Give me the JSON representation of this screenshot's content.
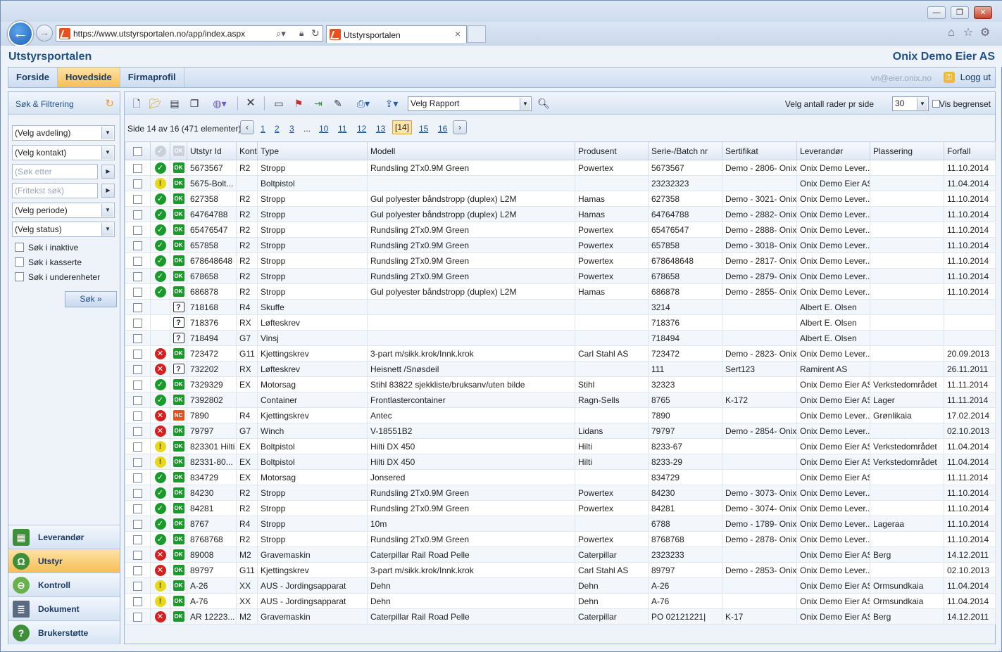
{
  "browser": {
    "url": "https://www.utstyrsportalen.no/app/index.aspx",
    "tab_title": "Utstyrsportalen"
  },
  "header": {
    "app_title": "Utstyrsportalen",
    "company": "Onix Demo Eier AS"
  },
  "menu": {
    "items": [
      {
        "label": "Forside"
      },
      {
        "label": "Hovedside"
      },
      {
        "label": "Firmaprofil"
      }
    ],
    "active": "Hovedside",
    "user_email": "vn@eier.onix.no",
    "logout": "Logg ut"
  },
  "sidebar": {
    "filter_title": "Søk & Filtrering",
    "selects": {
      "department": "(Velg avdeling)",
      "contact": "(Velg kontakt)",
      "period": "(Velg periode)",
      "status": "(Velg status)"
    },
    "inputs": {
      "supplier_placeholder": "(Søk etter leverandør)",
      "freetext_placeholder": "(Fritekst søk)"
    },
    "checkboxes": {
      "inactive": "Søk i inaktive",
      "discarded": "Søk i kasserte",
      "subunits": "Søk i underenheter"
    },
    "search_button": "Søk »",
    "nav": [
      {
        "label": "Leverandør"
      },
      {
        "label": "Utstyr"
      },
      {
        "label": "Kontroll"
      },
      {
        "label": "Dokument"
      },
      {
        "label": "Brukerstøtte"
      }
    ],
    "nav_active": "Utstyr"
  },
  "toolbar": {
    "report_select": "Velg Rapport",
    "rows_label": "Velg antall rader pr side",
    "rows_value": "30",
    "limited_label": "Vis begrenset"
  },
  "pager": {
    "text": "Side 14 av 16 (471 elementer)",
    "pages": [
      "1",
      "2",
      "3",
      "...",
      "10",
      "11",
      "12",
      "13",
      "[14]",
      "15",
      "16"
    ],
    "current": "[14]"
  },
  "grid": {
    "columns": [
      "Utstyr Id",
      "Kontr",
      "Type",
      "Modell",
      "Produsent",
      "Serie-/Batch nr",
      "Sertifikat",
      "Leverandør",
      "Plassering",
      "Forfall"
    ],
    "rows": [
      {
        "status": "ok",
        "cert": "ok",
        "id": "5673567",
        "kontr": "R2",
        "type": "Stropp",
        "modell": "Rundsling 2Tx0.9M Green",
        "produsent": "Powertex",
        "serie": "5673567",
        "sertifikat": "Demo - 2806- Onix",
        "leverandor": "Onix Demo Lever...",
        "plassering": "",
        "forfall": "11.10.2014"
      },
      {
        "status": "warn",
        "cert": "ok",
        "id": "5675-Bolt...",
        "kontr": "",
        "type": "Boltpistol",
        "modell": "",
        "produsent": "",
        "serie": "23232323",
        "sertifikat": "",
        "leverandor": "Onix Demo Eier AS",
        "plassering": "",
        "forfall": "11.04.2014"
      },
      {
        "status": "ok",
        "cert": "ok",
        "id": "627358",
        "kontr": "R2",
        "type": "Stropp",
        "modell": "Gul polyester båndstropp (duplex) L2M",
        "produsent": "Hamas",
        "serie": "627358",
        "sertifikat": "Demo - 3021- Onix",
        "leverandor": "Onix Demo Lever...",
        "plassering": "",
        "forfall": "11.10.2014"
      },
      {
        "status": "ok",
        "cert": "ok",
        "id": "64764788",
        "kontr": "R2",
        "type": "Stropp",
        "modell": "Gul polyester båndstropp (duplex) L2M",
        "produsent": "Hamas",
        "serie": "64764788",
        "sertifikat": "Demo - 2882- Onix",
        "leverandor": "Onix Demo Lever...",
        "plassering": "",
        "forfall": "11.10.2014"
      },
      {
        "status": "ok",
        "cert": "ok",
        "id": "65476547",
        "kontr": "R2",
        "type": "Stropp",
        "modell": "Rundsling 2Tx0.9M Green",
        "produsent": "Powertex",
        "serie": "65476547",
        "sertifikat": "Demo - 2888- Onix",
        "leverandor": "Onix Demo Lever...",
        "plassering": "",
        "forfall": "11.10.2014"
      },
      {
        "status": "ok",
        "cert": "ok",
        "id": "657858",
        "kontr": "R2",
        "type": "Stropp",
        "modell": "Rundsling 2Tx0.9M Green",
        "produsent": "Powertex",
        "serie": "657858",
        "sertifikat": "Demo - 3018- Onix",
        "leverandor": "Onix Demo Lever...",
        "plassering": "",
        "forfall": "11.10.2014"
      },
      {
        "status": "ok",
        "cert": "ok",
        "id": "678648648",
        "kontr": "R2",
        "type": "Stropp",
        "modell": "Rundsling 2Tx0.9M Green",
        "produsent": "Powertex",
        "serie": "678648648",
        "sertifikat": "Demo - 2817- Onix",
        "leverandor": "Onix Demo Lever...",
        "plassering": "",
        "forfall": "11.10.2014"
      },
      {
        "status": "ok",
        "cert": "ok",
        "id": "678658",
        "kontr": "R2",
        "type": "Stropp",
        "modell": "Rundsling 2Tx0.9M Green",
        "produsent": "Powertex",
        "serie": "678658",
        "sertifikat": "Demo - 2879- Onix",
        "leverandor": "Onix Demo Lever...",
        "plassering": "",
        "forfall": "11.10.2014"
      },
      {
        "status": "ok",
        "cert": "ok",
        "id": "686878",
        "kontr": "R2",
        "type": "Stropp",
        "modell": "Gul polyester båndstropp (duplex) L2M",
        "produsent": "Hamas",
        "serie": "686878",
        "sertifikat": "Demo - 2855- Onix",
        "leverandor": "Onix Demo Lever...",
        "plassering": "",
        "forfall": "11.10.2014"
      },
      {
        "status": "",
        "cert": "q",
        "id": "718168",
        "kontr": "R4",
        "type": "Skuffe",
        "modell": "",
        "produsent": "",
        "serie": "3214",
        "sertifikat": "",
        "leverandor": "Albert E. Olsen",
        "plassering": "",
        "forfall": ""
      },
      {
        "status": "",
        "cert": "q",
        "id": "718376",
        "kontr": "RX",
        "type": "Løfteskrev",
        "modell": "",
        "produsent": "",
        "serie": "718376",
        "sertifikat": "",
        "leverandor": "Albert E. Olsen",
        "plassering": "",
        "forfall": ""
      },
      {
        "status": "",
        "cert": "q",
        "id": "718494",
        "kontr": "G7",
        "type": "Vinsj",
        "modell": "",
        "produsent": "",
        "serie": "718494",
        "sertifikat": "",
        "leverandor": "Albert E. Olsen",
        "plassering": "",
        "forfall": ""
      },
      {
        "status": "err",
        "cert": "ok",
        "id": "723472",
        "kontr": "G11",
        "type": "Kjettingskrev",
        "modell": "3-part m/sikk.krok/Innk.krok",
        "produsent": "Carl Stahl AS",
        "serie": "723472",
        "sertifikat": "Demo - 2823- Onix",
        "leverandor": "Onix Demo Lever...",
        "plassering": "",
        "forfall": "20.09.2013"
      },
      {
        "status": "err",
        "cert": "q",
        "id": "732202",
        "kontr": "RX",
        "type": "Løfteskrev",
        "modell": "Heisnett /Snøsdeil",
        "produsent": "",
        "serie": "111",
        "sertifikat": "Sert123",
        "leverandor": "Ramirent AS",
        "plassering": "",
        "forfall": "26.11.2011"
      },
      {
        "status": "ok",
        "cert": "ok",
        "id": "7329329",
        "kontr": "EX",
        "type": "Motorsag",
        "modell": "Stihl 83822 sjekkliste/bruksanv/uten bilde",
        "produsent": "Stihl",
        "serie": "32323",
        "sertifikat": "",
        "leverandor": "Onix Demo Eier AS",
        "plassering": "Verkstedområdet",
        "forfall": "11.11.2014"
      },
      {
        "status": "ok",
        "cert": "ok",
        "id": "7392802",
        "kontr": "",
        "type": "Container",
        "modell": "Frontlastercontainer",
        "produsent": "Ragn-Sells",
        "serie": "8765",
        "sertifikat": "K-172",
        "leverandor": "Onix Demo Eier AS",
        "plassering": "Lager",
        "forfall": "11.11.2014"
      },
      {
        "status": "err",
        "cert": "nc",
        "id": "7890",
        "kontr": "R4",
        "type": "Kjettingskrev",
        "modell": "Antec",
        "produsent": "",
        "serie": "7890",
        "sertifikat": "",
        "leverandor": "Onix Demo Lever...",
        "plassering": "Grønlikaia",
        "forfall": "17.02.2014"
      },
      {
        "status": "err",
        "cert": "ok",
        "id": "79797",
        "kontr": "G7",
        "type": "Winch",
        "modell": "V-18551B2",
        "produsent": "Lidans",
        "serie": "79797",
        "sertifikat": "Demo - 2854- Onix",
        "leverandor": "Onix Demo Lever...",
        "plassering": "",
        "forfall": "02.10.2013"
      },
      {
        "status": "warn",
        "cert": "ok",
        "id": "823301 Hilti",
        "kontr": "EX",
        "type": "Boltpistol",
        "modell": "Hilti DX 450",
        "produsent": "Hilti",
        "serie": "8233-67",
        "sertifikat": "",
        "leverandor": "Onix Demo Eier AS",
        "plassering": "Verkstedområdet",
        "forfall": "11.04.2014"
      },
      {
        "status": "warn",
        "cert": "ok",
        "id": "82331-80...",
        "kontr": "EX",
        "type": "Boltpistol",
        "modell": "Hilti DX 450",
        "produsent": "Hilti",
        "serie": "8233-29",
        "sertifikat": "",
        "leverandor": "Onix Demo Eier AS",
        "plassering": "Verkstedområdet",
        "forfall": "11.04.2014"
      },
      {
        "status": "ok",
        "cert": "ok",
        "id": "834729",
        "kontr": "EX",
        "type": "Motorsag",
        "modell": "Jonsered",
        "produsent": "",
        "serie": "834729",
        "sertifikat": "",
        "leverandor": "Onix Demo Eier AS",
        "plassering": "",
        "forfall": "11.11.2014"
      },
      {
        "status": "ok",
        "cert": "ok",
        "id": "84230",
        "kontr": "R2",
        "type": "Stropp",
        "modell": "Rundsling 2Tx0.9M Green",
        "produsent": "Powertex",
        "serie": "84230",
        "sertifikat": "Demo - 3073- Onix",
        "leverandor": "Onix Demo Lever...",
        "plassering": "",
        "forfall": "11.10.2014"
      },
      {
        "status": "ok",
        "cert": "ok",
        "id": "84281",
        "kontr": "R2",
        "type": "Stropp",
        "modell": "Rundsling 2Tx0.9M Green",
        "produsent": "Powertex",
        "serie": "84281",
        "sertifikat": "Demo - 3074- Onix",
        "leverandor": "Onix Demo Lever...",
        "plassering": "",
        "forfall": "11.10.2014"
      },
      {
        "status": "ok",
        "cert": "ok",
        "id": "8767",
        "kontr": "R4",
        "type": "Stropp",
        "modell": "10m",
        "produsent": "",
        "serie": "6788",
        "sertifikat": "Demo - 1789- Onix",
        "leverandor": "Onix Demo Lever...",
        "plassering": "Lageraa",
        "forfall": "11.10.2014"
      },
      {
        "status": "ok",
        "cert": "ok",
        "id": "8768768",
        "kontr": "R2",
        "type": "Stropp",
        "modell": "Rundsling 2Tx0.9M Green",
        "produsent": "Powertex",
        "serie": "8768768",
        "sertifikat": "Demo - 2878- Onix",
        "leverandor": "Onix Demo Lever...",
        "plassering": "",
        "forfall": "11.10.2014"
      },
      {
        "status": "err",
        "cert": "ok",
        "id": "89008",
        "kontr": "M2",
        "type": "Gravemaskin",
        "modell": "Caterpillar Rail Road Pelle",
        "produsent": "Caterpillar",
        "serie": "2323233",
        "sertifikat": "",
        "leverandor": "Onix Demo Eier AS",
        "plassering": "Berg",
        "forfall": "14.12.2011"
      },
      {
        "status": "err",
        "cert": "ok",
        "id": "89797",
        "kontr": "G11",
        "type": "Kjettingskrev",
        "modell": "3-part m/sikk.krok/Innk.krok",
        "produsent": "Carl Stahl AS",
        "serie": "89797",
        "sertifikat": "Demo - 2853- Onix",
        "leverandor": "Onix Demo Lever...",
        "plassering": "",
        "forfall": "02.10.2013"
      },
      {
        "status": "warn",
        "cert": "ok",
        "id": "A-26",
        "kontr": "XX",
        "type": "AUS - Jordingsapparat",
        "modell": "Dehn",
        "produsent": "Dehn",
        "serie": "A-26",
        "sertifikat": "",
        "leverandor": "Onix Demo Eier AS",
        "plassering": "Ormsundkaia",
        "forfall": "11.04.2014"
      },
      {
        "status": "warn",
        "cert": "ok",
        "id": "A-76",
        "kontr": "XX",
        "type": "AUS - Jordingsapparat",
        "modell": "Dehn",
        "produsent": "Dehn",
        "serie": "A-76",
        "sertifikat": "",
        "leverandor": "Onix Demo Eier AS",
        "plassering": "Ormsundkaia",
        "forfall": "11.04.2014"
      },
      {
        "status": "err",
        "cert": "ok",
        "id": "AR 12223...",
        "kontr": "M2",
        "type": "Gravemaskin",
        "modell": "Caterpillar Rail Road Pelle",
        "produsent": "Caterpillar",
        "serie": "PO 02121221|",
        "sertifikat": "K-17",
        "leverandor": "Onix Demo Eier AS",
        "plassering": "Berg",
        "forfall": "14.12.2011"
      }
    ]
  },
  "status_labels": {
    "ok": "✓",
    "warn": "!",
    "err": "✕",
    "cert_ok": "OK",
    "cert_nc": "NC",
    "cert_q": "?"
  }
}
